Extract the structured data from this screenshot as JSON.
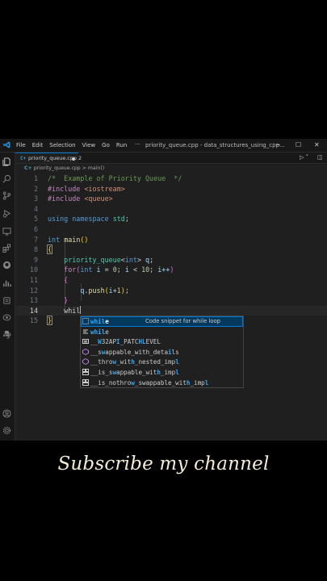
{
  "titlebar": {
    "menu": [
      "File",
      "Edit",
      "Selection",
      "View",
      "Go",
      "Run"
    ],
    "window_title": "priority_queue.cpp - data_structures_using_cpp...",
    "minimize": "─",
    "maximize": "☐",
    "close": "✕"
  },
  "tab": {
    "icon": "C+",
    "label": "priority_queue.cpp 2"
  },
  "breadcrumb": {
    "icon": "C+",
    "file": "priority_queue.cpp",
    "sep": ">",
    "symbol": "main()"
  },
  "code": {
    "lines": [
      {
        "n": "1"
      },
      {
        "n": "2"
      },
      {
        "n": "3"
      },
      {
        "n": "4"
      },
      {
        "n": "5"
      },
      {
        "n": "6"
      },
      {
        "n": "7"
      },
      {
        "n": "8"
      },
      {
        "n": "9"
      },
      {
        "n": "10"
      },
      {
        "n": "11"
      },
      {
        "n": "12"
      },
      {
        "n": "13"
      },
      {
        "n": "14"
      },
      {
        "n": "15"
      }
    ],
    "l1": "/*  Example of Priority Queue  */",
    "l2_pp": "#include",
    "l2_inc": "<iostream>",
    "l3_pp": "#include",
    "l3_inc": "<queue>",
    "l5_kw1": "using",
    "l5_kw2": "namespace",
    "l5_ns": "std",
    "semi": ";",
    "l7_type": "int",
    "l7_fn": "main",
    "parens": "()",
    "brace_open": "{",
    "brace_close": "}",
    "l9_type": "priority_queue",
    "l9_lt": "<",
    "l9_int": "int",
    "l9_gt": ">",
    "l9_var": "q",
    "l10_for": "for",
    "l10_int": "int",
    "l10_i": "i",
    "l10_zero": "0",
    "l10_ten": "10",
    "l10_inc": "i++",
    "l12_q": "q",
    "l12_push": "push",
    "l12_i": "i",
    "l12_one": "1",
    "l14_typed": "whil"
  },
  "suggestions": [
    {
      "icon": "snippet-icon",
      "prefix": "whil",
      "rest": "e",
      "detail": "Code snippet for while loop"
    },
    {
      "icon": "keyword-icon",
      "prefix": "whil",
      "rest": "e",
      "detail": ""
    },
    {
      "icon": "constant-icon",
      "pre": "__",
      "h1": "W",
      "mid": "32AP",
      "h2": "I",
      "post": "_PATC",
      "h3": "HL",
      "tail": "EVEL",
      "detail": ""
    },
    {
      "icon": "function-icon",
      "pre": "__s",
      "h1": "w",
      "mid": "appable_with_deta",
      "h2": "i",
      "post": "ls",
      "detail": ""
    },
    {
      "icon": "function-icon",
      "pre": "__thro",
      "h1": "w",
      "mid": "_wit",
      "h2": "h",
      "post": "_nested_imp",
      "h3": "l",
      "detail": ""
    },
    {
      "icon": "struct-icon",
      "pre": "__is_s",
      "h1": "w",
      "mid": "appable_wit",
      "h2": "h",
      "post": "_imp",
      "h3": "l",
      "detail": ""
    },
    {
      "icon": "struct-icon",
      "pre": "__is_nothro",
      "h1": "w",
      "mid": "_swappable_wit",
      "h2": "h",
      "post": "_imp",
      "h3": "l",
      "detail": ""
    }
  ],
  "banner": "Subscribe my channel",
  "colors": {
    "accent": "#0078d4",
    "editor_bg": "#1f1f1f",
    "highlight": "#2aaaff"
  }
}
